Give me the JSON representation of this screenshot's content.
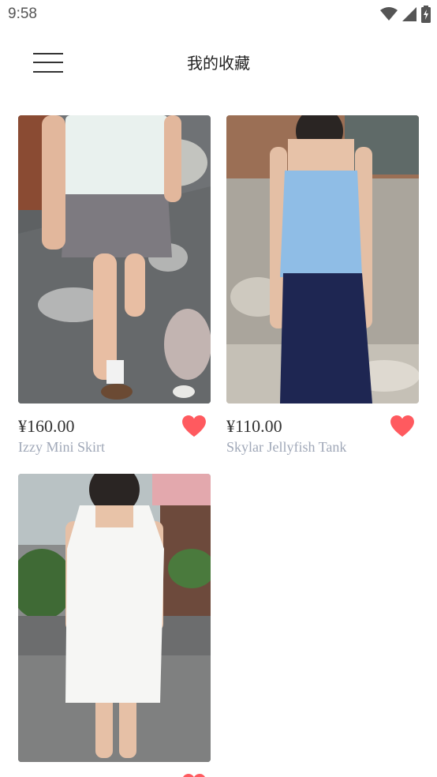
{
  "status_bar": {
    "time": "9:58",
    "icons": [
      "wifi-icon",
      "cellular-signal-icon",
      "battery-charging-icon"
    ]
  },
  "header": {
    "title": "我的收藏",
    "menu_icon": "hamburger-menu-icon"
  },
  "colors": {
    "heart": "#ff5a5f",
    "price": "#333333",
    "name": "#a0a8b8",
    "title": "#222222"
  },
  "products": [
    {
      "price": "¥160.00",
      "name": "Izzy Mini Skirt",
      "favorited": true,
      "image": "woman-white-blouse-grey-mini-skirt-photo"
    },
    {
      "price": "¥110.00",
      "name": "Skylar Jellyfish Tank",
      "favorited": true,
      "image": "woman-blue-tank-navy-skirt-photo"
    },
    {
      "price": "",
      "name": "",
      "favorited": true,
      "image": "woman-white-eyelet-dress-photo"
    }
  ]
}
